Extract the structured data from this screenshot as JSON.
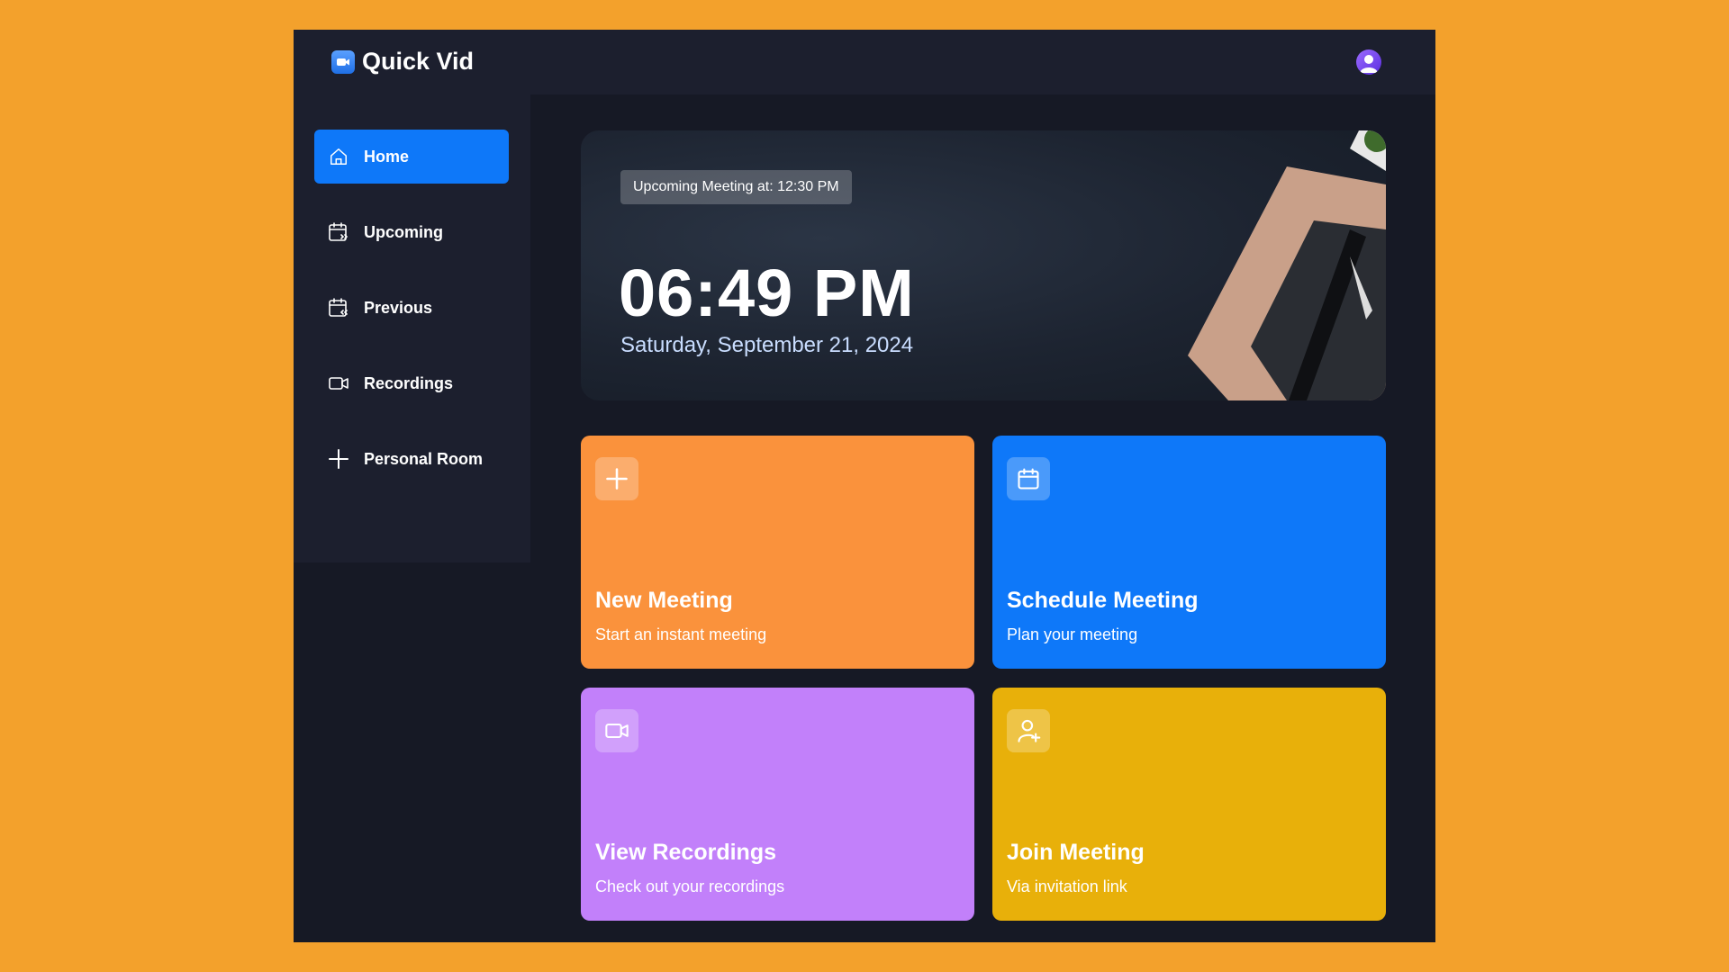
{
  "app": {
    "title": "Quick Vid"
  },
  "colors": {
    "page_bg": "#F3A12C",
    "active_nav": "#0E78F9",
    "card_orange": "#FA923C",
    "card_blue": "#0E78F9",
    "card_purple": "#C280FA",
    "card_yellow": "#E8B00A"
  },
  "topbar": {
    "logo_icon": "video-camera-icon",
    "avatar_icon": "user-avatar-icon"
  },
  "sidebar": {
    "items": [
      {
        "label": "Home",
        "icon": "home-icon",
        "active": true
      },
      {
        "label": "Upcoming",
        "icon": "calendar-forward-icon"
      },
      {
        "label": "Previous",
        "icon": "calendar-back-icon"
      },
      {
        "label": "Recordings",
        "icon": "video-icon"
      },
      {
        "label": "Personal Room",
        "icon": "plus-icon"
      }
    ]
  },
  "hero": {
    "badge": "Upcoming Meeting at: 12:30 PM",
    "time": "06:49 PM",
    "date": "Saturday, September 21, 2024"
  },
  "cards": [
    {
      "title": "New Meeting",
      "subtitle": "Start an instant meeting",
      "icon": "plus-icon"
    },
    {
      "title": "Schedule Meeting",
      "subtitle": "Plan your meeting",
      "icon": "calendar-icon"
    },
    {
      "title": "View Recordings",
      "subtitle": "Check out your recordings",
      "icon": "video-icon"
    },
    {
      "title": "Join Meeting",
      "subtitle": "Via invitation link",
      "icon": "user-plus-icon"
    }
  ]
}
